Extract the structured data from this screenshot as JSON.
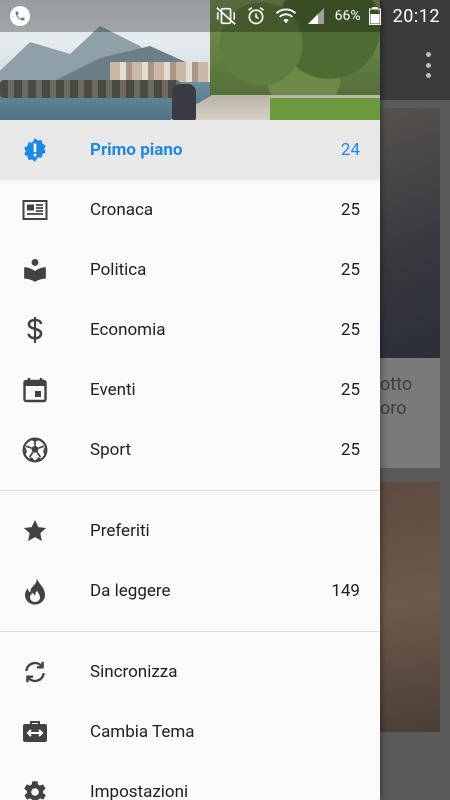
{
  "status_bar": {
    "battery_percent": "66%",
    "time": "20:12"
  },
  "background_app": {
    "card_text": "otto\noro"
  },
  "drawer": {
    "header_image": "Waterfront promenade with mountains and sea",
    "section_primary": [
      {
        "label": "Primo piano",
        "count": "24",
        "icon": "alert-badge-icon",
        "active": true
      },
      {
        "label": "Cronaca",
        "count": "25",
        "icon": "newspaper-icon",
        "active": false
      },
      {
        "label": "Politica",
        "count": "25",
        "icon": "reading-person-icon",
        "active": false
      },
      {
        "label": "Economia",
        "count": "25",
        "icon": "dollar-icon",
        "active": false
      },
      {
        "label": "Eventi",
        "count": "25",
        "icon": "calendar-icon",
        "active": false
      },
      {
        "label": "Sport",
        "count": "25",
        "icon": "soccer-ball-icon",
        "active": false
      }
    ],
    "section_saved": [
      {
        "label": "Preferiti",
        "count": "",
        "icon": "star-icon"
      },
      {
        "label": "Da leggere",
        "count": "149",
        "icon": "flame-icon"
      }
    ],
    "section_settings": [
      {
        "label": "Sincronizza",
        "count": "",
        "icon": "sync-icon"
      },
      {
        "label": "Cambia Tema",
        "count": "",
        "icon": "swap-briefcase-icon"
      },
      {
        "label": "Impostazioni",
        "count": "",
        "icon": "gear-icon"
      }
    ]
  },
  "colors": {
    "accent": "#1e88e5",
    "active_bg": "#e8e8e8",
    "drawer_bg": "#fafafa",
    "icon": "#424242"
  }
}
